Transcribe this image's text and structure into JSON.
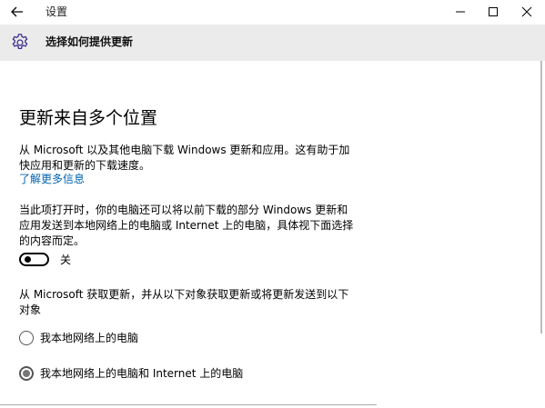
{
  "window": {
    "title": "设置",
    "controls": [
      "minimize",
      "maximize",
      "close"
    ]
  },
  "header": {
    "icon": "gear-icon",
    "title": "选择如何提供更新"
  },
  "main": {
    "section_title": "更新来自多个位置",
    "description": "从 Microsoft 以及其他电脑下载 Windows 更新和应用。这有助于加快应用和更新的下载速度。",
    "learn_more_link": "了解更多信息",
    "toggle_description": "当此项打开时，你的电脑还可以将以前下载的部分 Windows 更新和应用发送到本地网络上的电脑或 Internet 上的电脑，具体视下面选择的内容而定。",
    "toggle": {
      "state": "off",
      "label": "关"
    },
    "options_description": "从 Microsoft 获取更新，并从以下对象获取更新或将更新发送到以下对象",
    "options": [
      {
        "label": "我本地网络上的电脑",
        "selected": false
      },
      {
        "label": "我本地网络上的电脑和 Internet 上的电脑",
        "selected": true
      }
    ]
  },
  "colors": {
    "header_bg": "#ebebeb",
    "link": "#0063b1",
    "gear": "#3a2d8c"
  }
}
